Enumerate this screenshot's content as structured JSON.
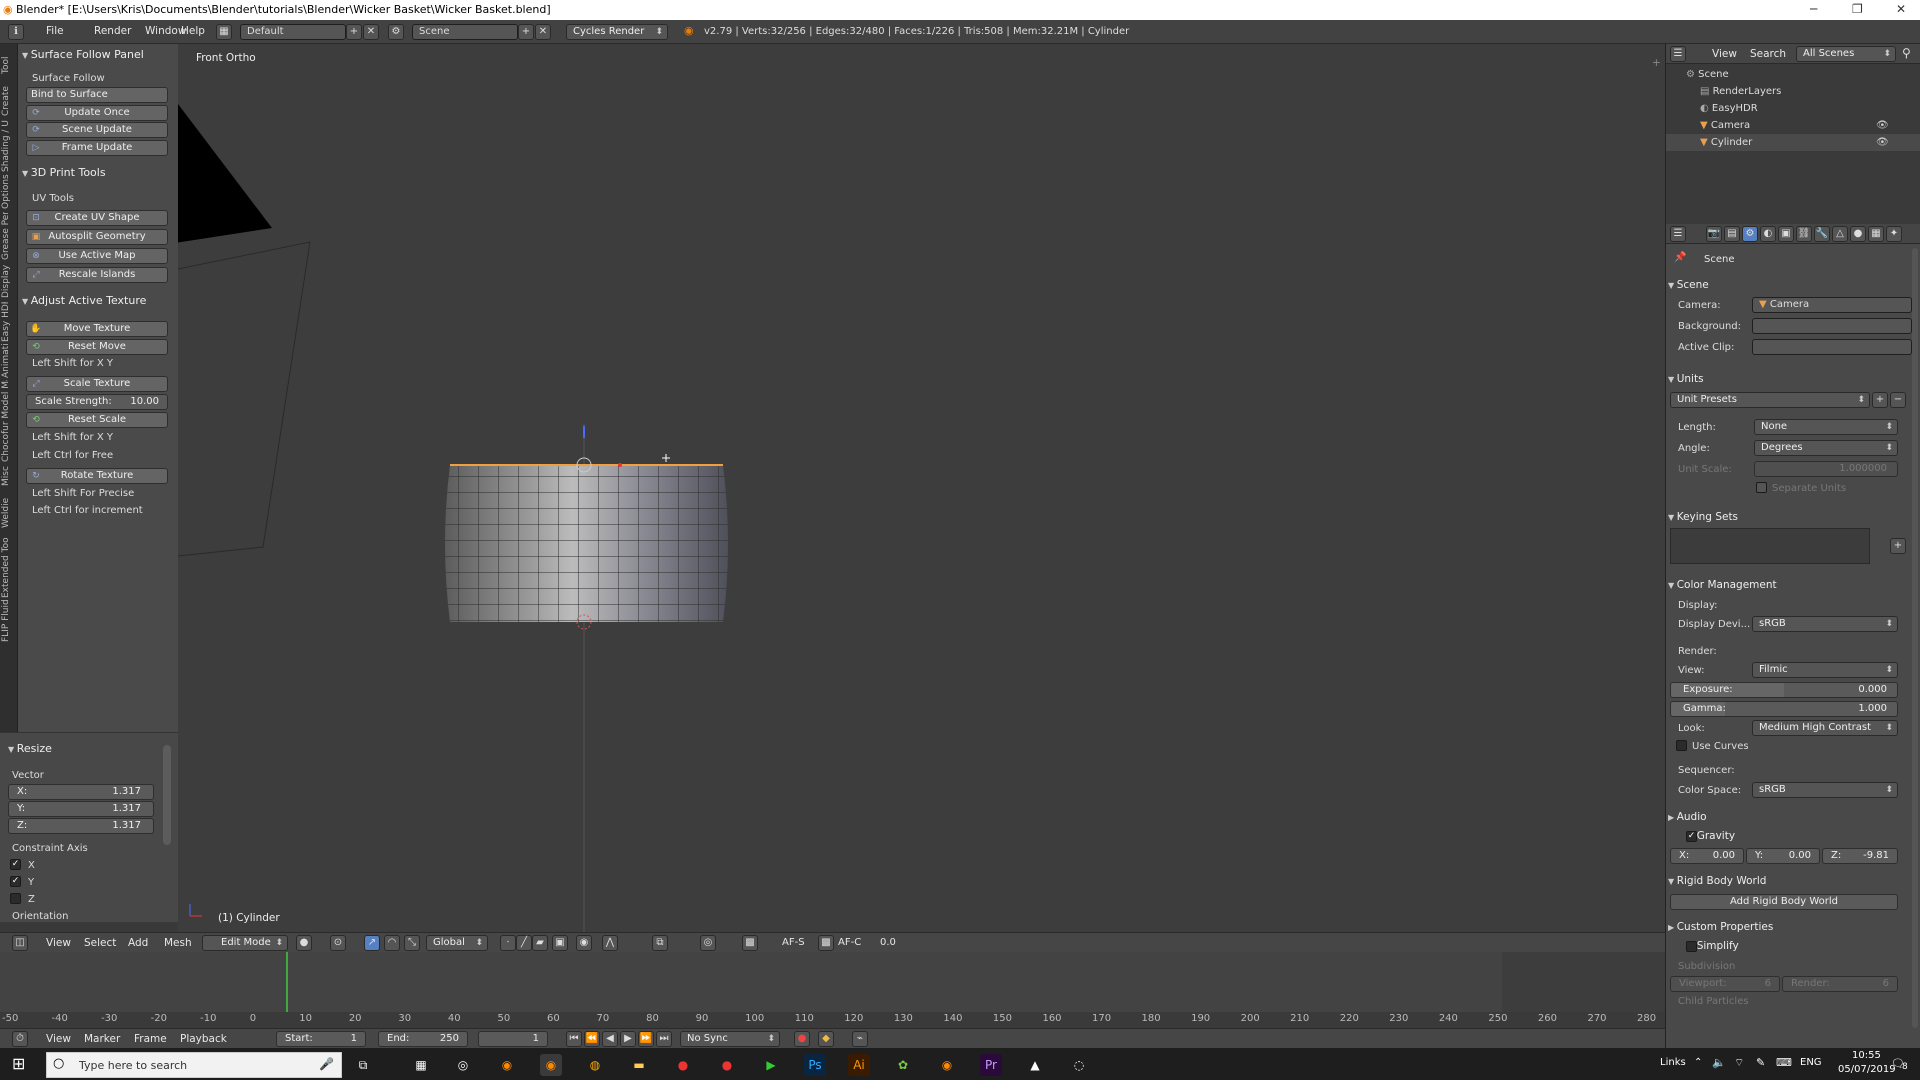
{
  "window": {
    "title": "Blender* [E:\\Users\\Kris\\Documents\\Blender\\tutorials\\Blender\\Wicker Basket\\Wicker Basket.blend]"
  },
  "menubar": {
    "items": [
      "File",
      "Render",
      "Window",
      "Help"
    ],
    "layout": "Default",
    "scene": "Scene",
    "engine": "Cycles Render",
    "stats": "v2.79 | Verts:32/256 | Edges:32/480 | Faces:1/226 | Tris:508 | Mem:32.21M | Cylinder"
  },
  "left_tabs": [
    "Tool",
    "Create",
    "Shading / UV",
    "Options",
    "Grease Pencil",
    "Display",
    "Easy HDRI",
    "Animation",
    "Chocofur Model Manager",
    "Misc",
    "Weldie",
    "Extended Tools",
    "FLIP Fluid"
  ],
  "tool_shelf": {
    "surface_follow": {
      "header": "Surface Follow Panel",
      "label": "Surface Follow",
      "bind_button": "Bind to Surface",
      "buttons": [
        "Update Once",
        "Scene Update",
        "Frame Update"
      ]
    },
    "print_tools": {
      "header": "3D Print Tools",
      "label": "UV Tools",
      "buttons": [
        "Create UV Shape",
        "Autosplit Geometry",
        "Use Active Map",
        "Rescale Islands"
      ]
    },
    "adjust_texture": {
      "header": "Adjust Active Texture",
      "move": "Move Texture",
      "reset_move": "Reset Move",
      "hint1": "Left Shift for X Y",
      "scale": "Scale Texture",
      "strength_label": "Scale Strength:",
      "strength_value": "10.00",
      "reset_scale": "Reset Scale",
      "hint2": "Left Shift for X Y",
      "hint3": "Left Ctrl for Free",
      "rotate": "Rotate Texture",
      "hint4": "Left Shift For Precise",
      "hint5": "Left Ctrl for increment"
    }
  },
  "resize_panel": {
    "header": "Resize",
    "vector_label": "Vector",
    "x_label": "X:",
    "x": "1.317",
    "y_label": "Y:",
    "y": "1.317",
    "z_label": "Z:",
    "z": "1.317",
    "constraint_label": "Constraint Axis",
    "cx": "X",
    "cy": "Y",
    "cz": "Z",
    "cx_checked": true,
    "cy_checked": true,
    "cz_checked": false,
    "orientation_label": "Orientation"
  },
  "viewport": {
    "view_name": "Front Ortho",
    "object_label": "(1) Cylinder"
  },
  "viewport_header": {
    "view": "View",
    "select": "Select",
    "add": "Add",
    "mesh": "Mesh",
    "mode": "Edit Mode",
    "orientation": "Global",
    "afs": "AF-S",
    "afc": "AF-C",
    "value": "0.0"
  },
  "timeline": {
    "ticks": [
      "-50",
      "-40",
      "-30",
      "-20",
      "-10",
      "0",
      "10",
      "20",
      "30",
      "40",
      "50",
      "60",
      "70",
      "80",
      "90",
      "100",
      "110",
      "120",
      "130",
      "140",
      "150",
      "160",
      "170",
      "180",
      "190",
      "200",
      "210",
      "220",
      "230",
      "240",
      "250",
      "260",
      "270",
      "280"
    ],
    "current_frame": 1
  },
  "timeline_header": {
    "view": "View",
    "marker": "Marker",
    "frame": "Frame",
    "playback": "Playback",
    "start_label": "Start:",
    "start": "1",
    "end_label": "End:",
    "end": "250",
    "current": "1",
    "sync": "No Sync"
  },
  "outliner": {
    "view": "View",
    "search": "Search",
    "filter": "All Scenes",
    "rows": [
      "Scene",
      "RenderLayers",
      "EasyHDR",
      "Camera",
      "Cylinder"
    ]
  },
  "properties": {
    "context": "Scene",
    "scene_section": "Scene",
    "camera_label": "Camera:",
    "camera_value": "Camera",
    "background_label": "Background:",
    "active_clip_label": "Active Clip:",
    "units_section": "Units",
    "unit_presets": "Unit Presets",
    "length_label": "Length:",
    "length_value": "None",
    "angle_label": "Angle:",
    "angle_value": "Degrees",
    "unit_scale_label": "Unit Scale:",
    "unit_scale_value": "1.000000",
    "separate_units": "Separate Units",
    "keying_sets_section": "Keying Sets",
    "color_mgmt_section": "Color Management",
    "display_label": "Display:",
    "display_device_label": "Display Devi...",
    "display_device_value": "sRGB",
    "render_label": "Render:",
    "view_label": "View:",
    "view_value": "Filmic",
    "exposure_label": "Exposure:",
    "exposure_value": "0.000",
    "gamma_label": "Gamma:",
    "gamma_value": "1.000",
    "look_label": "Look:",
    "look_value": "Medium High Contrast",
    "use_curves": "Use Curves",
    "sequencer_label": "Sequencer:",
    "color_space_label": "Color Space:",
    "color_space_value": "sRGB",
    "audio_section": "Audio",
    "gravity_section": "Gravity",
    "gx_label": "X:",
    "gx": "0.00",
    "gy_label": "Y:",
    "gy": "0.00",
    "gz_label": "Z:",
    "gz": "-9.81",
    "rigid_section": "Rigid Body World",
    "rigid_button": "Add Rigid Body World",
    "custom_props_section": "Custom Properties",
    "simplify_section": "Simplify",
    "subdivision_label": "Subdivision",
    "viewport_label": "Viewport:",
    "viewport_value": "6",
    "render_sub_label": "Render:",
    "render_sub_value": "6",
    "child_particles": "Child Particles"
  },
  "taskbar": {
    "search_placeholder": "Type here to search",
    "links": "Links",
    "lang": "ENG",
    "time": "10:55",
    "date": "05/07/2019",
    "notif": "8"
  },
  "colors": {
    "accent": "#5680c2",
    "timeline_cursor": "#3fa83f",
    "selected_edge": "#f0a040"
  }
}
